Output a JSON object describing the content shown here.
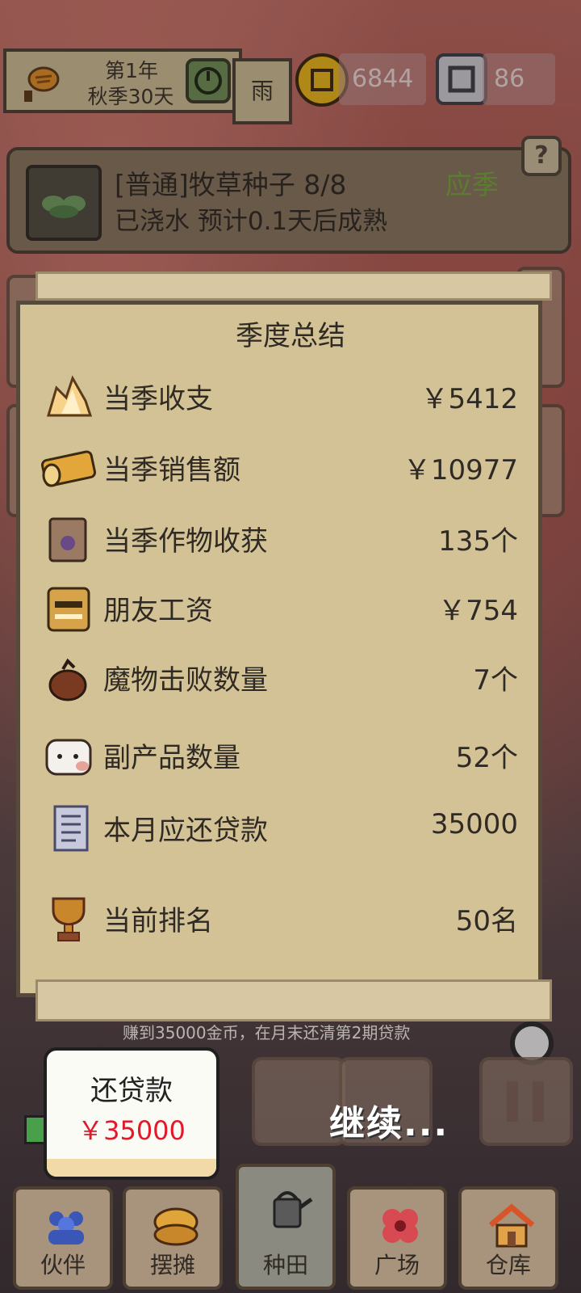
{
  "status_bar": {
    "year": "第1年",
    "season_day": "秋季30天",
    "weather": "雨",
    "coins": "6844",
    "gems": "86"
  },
  "crop": {
    "title": "[普通]牧草种子 8/8",
    "season_tag": "应季",
    "status": "已浇水 预计0.1天后成熟",
    "help": "?"
  },
  "quest": {
    "text": "赚到35000金币，在月末还清第2期贷款"
  },
  "summary": {
    "title": "季度总结",
    "rows": [
      {
        "label": "当季收支",
        "value": "￥5412",
        "icon": "crystal-icon"
      },
      {
        "label": "当季销售额",
        "value": "￥10977",
        "icon": "bread-icon"
      },
      {
        "label": "当季作物收获",
        "value": "135个",
        "icon": "seed-bag-icon"
      },
      {
        "label": "朋友工资",
        "value": "￥754",
        "icon": "friend-icon"
      },
      {
        "label": "魔物击败数量",
        "value": "7个",
        "icon": "loot-bag-icon"
      },
      {
        "label": "副产品数量",
        "value": "52个",
        "icon": "sheep-icon"
      },
      {
        "label": "本月应还贷款",
        "value": "35000",
        "icon": "document-icon"
      },
      {
        "label": "当前排名",
        "value": "50名",
        "icon": "trophy-icon"
      }
    ]
  },
  "continue_label": "继续...",
  "repay": {
    "label": "还贷款",
    "amount": "￥35000"
  },
  "nav": [
    {
      "label": "伙伴",
      "icon": "people-icon"
    },
    {
      "label": "摆摊",
      "icon": "stall-icon"
    },
    {
      "label": "种田",
      "icon": "watering-can-icon"
    },
    {
      "label": "广场",
      "icon": "flower-icon"
    },
    {
      "label": "仓库",
      "icon": "house-icon"
    }
  ],
  "colors": {
    "panel": "#d3c296",
    "season_green": "#74a33d",
    "repay_red": "#e3182a"
  }
}
